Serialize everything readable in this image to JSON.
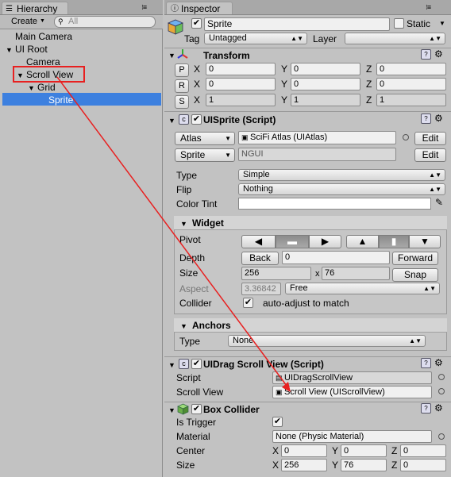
{
  "hierarchy": {
    "tab_label": "Hierarchy",
    "create_label": "Create",
    "search_placeholder": "All",
    "items": [
      {
        "label": "Main Camera"
      },
      {
        "label": "UI Root"
      },
      {
        "label": "Camera"
      },
      {
        "label": "Scroll View"
      },
      {
        "label": "Grid"
      },
      {
        "label": "Sprite"
      }
    ]
  },
  "inspector": {
    "tab_label": "Inspector",
    "object_name": "Sprite",
    "static_label": "Static",
    "tag_label": "Tag",
    "tag_value": "Untagged",
    "layer_label": "Layer",
    "layer_value": ""
  },
  "transform": {
    "title": "Transform",
    "rows": [
      {
        "btn": "P",
        "x": "0",
        "y": "0",
        "z": "0"
      },
      {
        "btn": "R",
        "x": "0",
        "y": "0",
        "z": "0"
      },
      {
        "btn": "S",
        "x": "1",
        "y": "1",
        "z": "1"
      }
    ],
    "x_label": "X",
    "y_label": "Y",
    "z_label": "Z"
  },
  "uisprite": {
    "title": "UISprite (Script)",
    "atlas_btn": "Atlas",
    "atlas_value": "SciFi Atlas (UIAtlas)",
    "sprite_btn": "Sprite",
    "sprite_value": "NGUI",
    "edit_label": "Edit",
    "type_label": "Type",
    "type_value": "Simple",
    "flip_label": "Flip",
    "flip_value": "Nothing",
    "tint_label": "Color Tint"
  },
  "widget": {
    "title": "Widget",
    "pivot_label": "Pivot",
    "depth_label": "Depth",
    "back_label": "Back",
    "depth_value": "0",
    "forward_label": "Forward",
    "size_label": "Size",
    "size_w": "256",
    "size_x": "x",
    "size_h": "76",
    "snap_label": "Snap",
    "aspect_label": "Aspect",
    "aspect_value": "3.36842",
    "aspect_mode": "Free",
    "collider_label": "Collider",
    "collider_text": "auto-adjust to match"
  },
  "anchors": {
    "title": "Anchors",
    "type_label": "Type",
    "type_value": "None"
  },
  "dragscroll": {
    "title": "UIDrag Scroll View (Script)",
    "script_label": "Script",
    "script_value": "UIDragScrollView",
    "scrollview_label": "Scroll View",
    "scrollview_value": "Scroll View (UIScrollView)"
  },
  "boxcollider": {
    "title": "Box Collider",
    "trigger_label": "Is Trigger",
    "material_label": "Material",
    "material_value": "None (Physic Material)",
    "center_label": "Center",
    "center": {
      "x": "0",
      "y": "0",
      "z": "0"
    },
    "size_label": "Size",
    "size": {
      "x": "256",
      "y": "76",
      "z": "0"
    },
    "x_label": "X",
    "y_label": "Y",
    "z_label": "Z"
  },
  "colors": {
    "selection": "#3d80df",
    "annotation": "#e82020"
  }
}
